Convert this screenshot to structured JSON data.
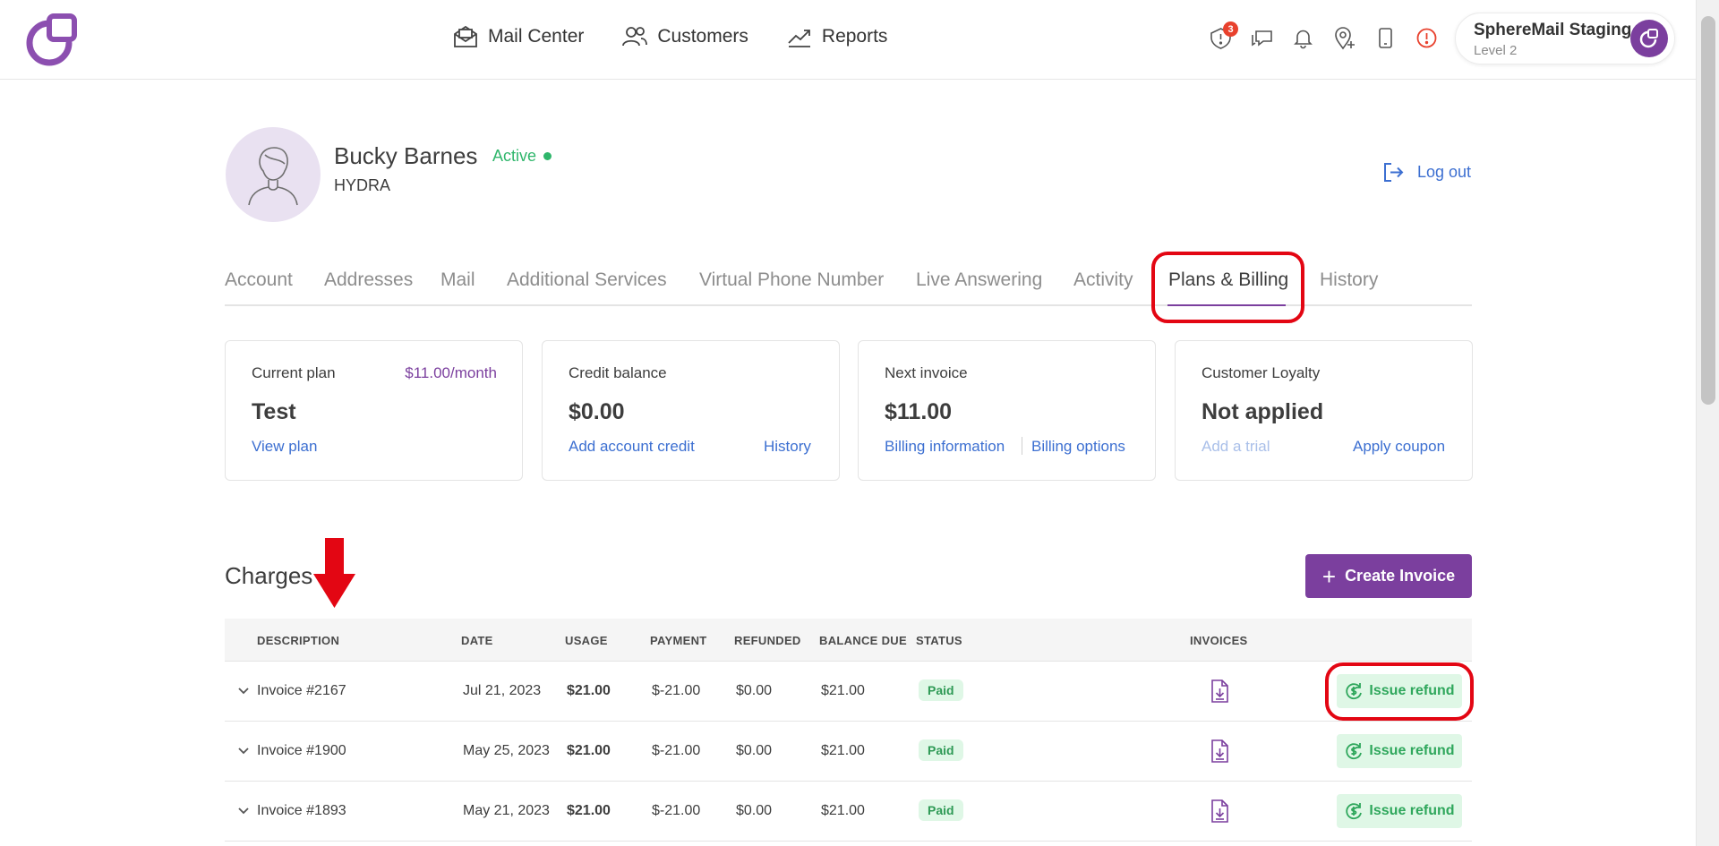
{
  "header": {
    "nav": [
      {
        "label": "Mail Center",
        "icon": "mail-icon"
      },
      {
        "label": "Customers",
        "icon": "users-icon"
      },
      {
        "label": "Reports",
        "icon": "chart-line-icon"
      }
    ],
    "notification_count": "3",
    "account_name": "SphereMail Staging",
    "account_level": "Level 2"
  },
  "profile": {
    "name": "Bucky Barnes",
    "status": "Active",
    "company": "HYDRA",
    "logout_label": "Log out"
  },
  "tabs": [
    {
      "label": "Account"
    },
    {
      "label": "Addresses"
    },
    {
      "label": "Mail"
    },
    {
      "label": "Additional Services"
    },
    {
      "label": "Virtual Phone Number"
    },
    {
      "label": "Live Answering"
    },
    {
      "label": "Activity"
    },
    {
      "label": "Plans & Billing"
    },
    {
      "label": "History"
    }
  ],
  "cards": {
    "current_plan": {
      "label": "Current plan",
      "price": "$11.00/month",
      "value": "Test",
      "link": "View plan"
    },
    "credit_balance": {
      "label": "Credit balance",
      "value": "$0.00",
      "link1": "Add account credit",
      "link2": "History"
    },
    "next_invoice": {
      "label": "Next invoice",
      "value": "$11.00",
      "link1": "Billing information",
      "link2": "Billing options"
    },
    "loyalty": {
      "label": "Customer Loyalty",
      "value": "Not applied",
      "link1": "Add a trial",
      "link2": "Apply coupon"
    }
  },
  "charges": {
    "title": "Charges",
    "create_label": "Create Invoice",
    "columns": [
      "DESCRIPTION",
      "DATE",
      "USAGE",
      "PAYMENT",
      "REFUNDED",
      "BALANCE DUE",
      "STATUS",
      "INVOICES"
    ],
    "rows": [
      {
        "description": "Invoice #2167",
        "date": "Jul 21, 2023",
        "usage": "$21.00",
        "payment": "$-21.00",
        "refunded": "$0.00",
        "balance": "$21.00",
        "status": "Paid",
        "action": "Issue refund"
      },
      {
        "description": "Invoice #1900",
        "date": "May 25, 2023",
        "usage": "$21.00",
        "payment": "$-21.00",
        "refunded": "$0.00",
        "balance": "$21.00",
        "status": "Paid",
        "action": "Issue refund"
      },
      {
        "description": "Invoice #1893",
        "date": "May 21, 2023",
        "usage": "$21.00",
        "payment": "$-21.00",
        "refunded": "$0.00",
        "balance": "$21.00",
        "status": "Paid",
        "action": "Issue refund"
      }
    ]
  },
  "colors": {
    "brand": "#7b3f9e",
    "link": "#3c6fd1",
    "success": "#2fb66b",
    "annotation": "#e30613"
  }
}
